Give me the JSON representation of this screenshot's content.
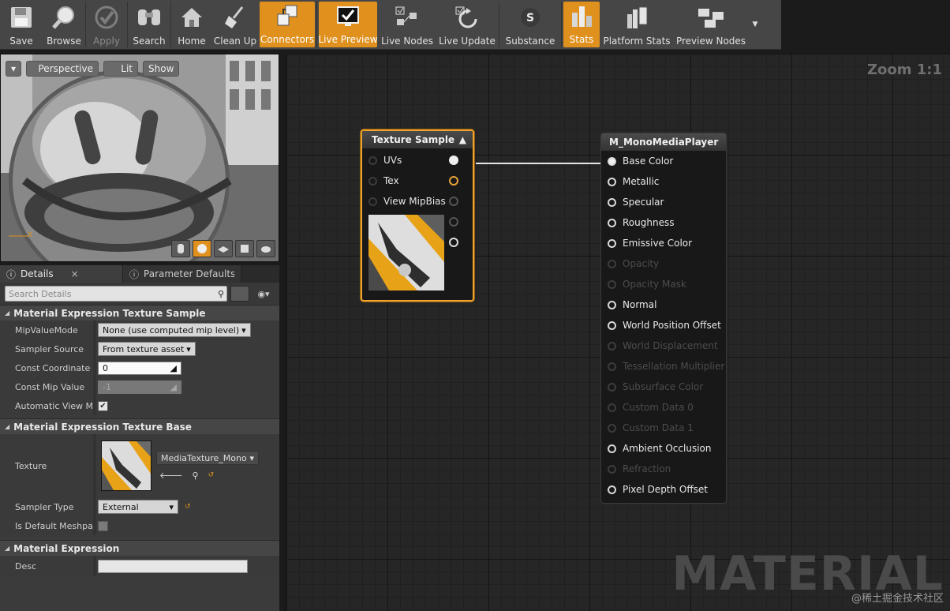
{
  "toolbar": {
    "buttons": [
      {
        "label": "Save",
        "icon": "floppy-disk-icon",
        "state": "normal"
      },
      {
        "label": "Browse",
        "icon": "magnifier-icon",
        "state": "normal"
      },
      {
        "label": "Apply",
        "icon": "checkmark-icon",
        "state": "disabled"
      },
      {
        "label": "Search",
        "icon": "binoculars-icon",
        "state": "normal"
      },
      {
        "label": "Home",
        "icon": "house-icon",
        "state": "normal"
      },
      {
        "label": "Clean Up",
        "icon": "broom-icon",
        "state": "normal"
      },
      {
        "label": "Connectors",
        "icon": "connectors-icon",
        "state": "active"
      },
      {
        "label": "Live Preview",
        "icon": "monitor-check-icon",
        "state": "active"
      },
      {
        "label": "Live Nodes",
        "icon": "live-nodes-icon",
        "state": "normal"
      },
      {
        "label": "Live Update",
        "icon": "refresh-icon",
        "state": "normal"
      },
      {
        "label": "Substance",
        "icon": "substance-icon",
        "state": "normal"
      },
      {
        "label": "Stats",
        "icon": "bar-stats-icon",
        "state": "active"
      },
      {
        "label": "Platform Stats",
        "icon": "platform-stats-icon",
        "state": "normal"
      },
      {
        "label": "Preview Nodes",
        "icon": "preview-nodes-icon",
        "state": "normal"
      }
    ]
  },
  "viewport": {
    "perspective_label": "Perspective",
    "lit_label": "Lit",
    "show_label": "Show",
    "axis_label": "X"
  },
  "details": {
    "tabs": [
      {
        "label": "Details",
        "active": true
      },
      {
        "label": "Parameter Defaults",
        "active": false
      }
    ],
    "search_placeholder": "Search Details",
    "categories": {
      "texture_sample": {
        "title": "Material Expression Texture Sample",
        "mip_value_mode_label": "MipValueMode",
        "mip_value_mode_value": "None (use computed mip level)",
        "sampler_source_label": "Sampler Source",
        "sampler_source_value": "From texture asset",
        "const_coordinate_label": "Const Coordinate",
        "const_coordinate_value": "0",
        "const_mip_value_label": "Const Mip Value",
        "const_mip_value_value": "-1",
        "auto_view_mip_label": "Automatic View Mip",
        "auto_view_mip_checked": true
      },
      "texture_base": {
        "title": "Material Expression Texture Base",
        "texture_label": "Texture",
        "texture_value": "MediaTexture_MonoMe",
        "sampler_type_label": "Sampler Type",
        "sampler_type_value": "External",
        "is_default_meshpaint_label": "Is Default Meshpain",
        "is_default_meshpaint_checked": false
      },
      "expression": {
        "title": "Material Expression",
        "desc_label": "Desc",
        "desc_value": ""
      }
    }
  },
  "graph": {
    "zoom_label": "Zoom 1:1",
    "watermark": "MATERIAL",
    "credit": "@稀土掘金技术社区",
    "texture_node": {
      "title": "Texture Sample",
      "inputs": [
        "UVs",
        "Tex",
        "View MipBias"
      ]
    },
    "material_node": {
      "title": "M_MonoMediaPlayer",
      "pins": [
        {
          "label": "Base Color",
          "active": true,
          "connected": true
        },
        {
          "label": "Metallic",
          "active": true,
          "connected": false
        },
        {
          "label": "Specular",
          "active": true,
          "connected": false
        },
        {
          "label": "Roughness",
          "active": true,
          "connected": false
        },
        {
          "label": "Emissive Color",
          "active": true,
          "connected": false
        },
        {
          "label": "Opacity",
          "active": false,
          "connected": false
        },
        {
          "label": "Opacity Mask",
          "active": false,
          "connected": false
        },
        {
          "label": "Normal",
          "active": true,
          "connected": false
        },
        {
          "label": "World Position Offset",
          "active": true,
          "connected": false
        },
        {
          "label": "World Displacement",
          "active": false,
          "connected": false
        },
        {
          "label": "Tessellation Multiplier",
          "active": false,
          "connected": false
        },
        {
          "label": "Subsurface Color",
          "active": false,
          "connected": false
        },
        {
          "label": "Custom Data 0",
          "active": false,
          "connected": false
        },
        {
          "label": "Custom Data 1",
          "active": false,
          "connected": false
        },
        {
          "label": "Ambient Occlusion",
          "active": true,
          "connected": false
        },
        {
          "label": "Refraction",
          "active": false,
          "connected": false
        },
        {
          "label": "Pixel Depth Offset",
          "active": true,
          "connected": false
        }
      ]
    }
  },
  "colors": {
    "accent": "#e0901d",
    "node_selected_border": "#f0a32a"
  }
}
